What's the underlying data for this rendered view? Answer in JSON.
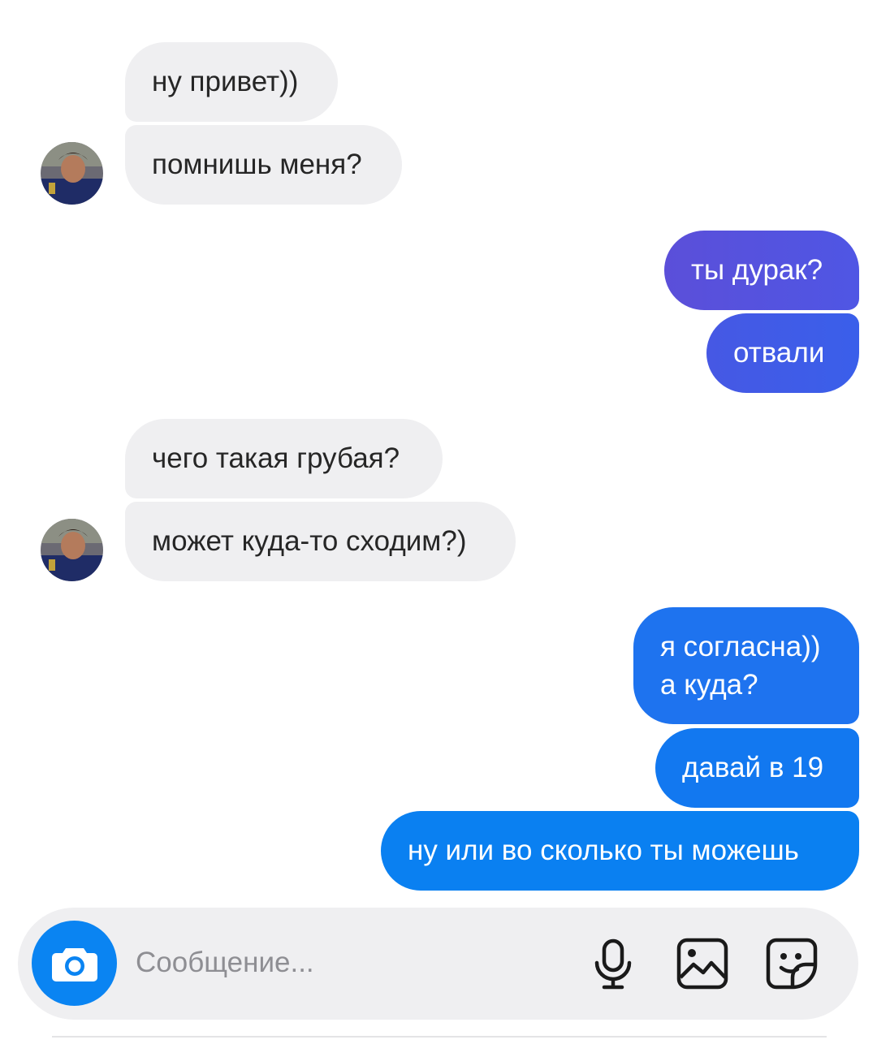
{
  "messages": [
    {
      "text": "ну привет))",
      "direction": "incoming"
    },
    {
      "text": "помнишь меня?",
      "direction": "incoming"
    },
    {
      "text": "ты дурак?",
      "direction": "outgoing"
    },
    {
      "text": "отвали",
      "direction": "outgoing"
    },
    {
      "text": "чего такая грубая?",
      "direction": "incoming"
    },
    {
      "text": "может куда-то сходим?)",
      "direction": "incoming"
    },
    {
      "text": "я согласна))\nа куда?",
      "direction": "outgoing"
    },
    {
      "text": "давай в 19",
      "direction": "outgoing"
    },
    {
      "text": "ну или во сколько ты можешь",
      "direction": "outgoing"
    }
  ],
  "composer": {
    "placeholder": "Сообщение...",
    "icons": [
      "camera-icon",
      "microphone-icon",
      "gallery-icon",
      "sticker-icon"
    ]
  },
  "colors": {
    "incoming_bg": "#efeff1",
    "outgoing_gradient_top": "#5a4ad8",
    "outgoing_gradient_bottom": "#0a84f2",
    "camera_button": "#0a84f2"
  }
}
